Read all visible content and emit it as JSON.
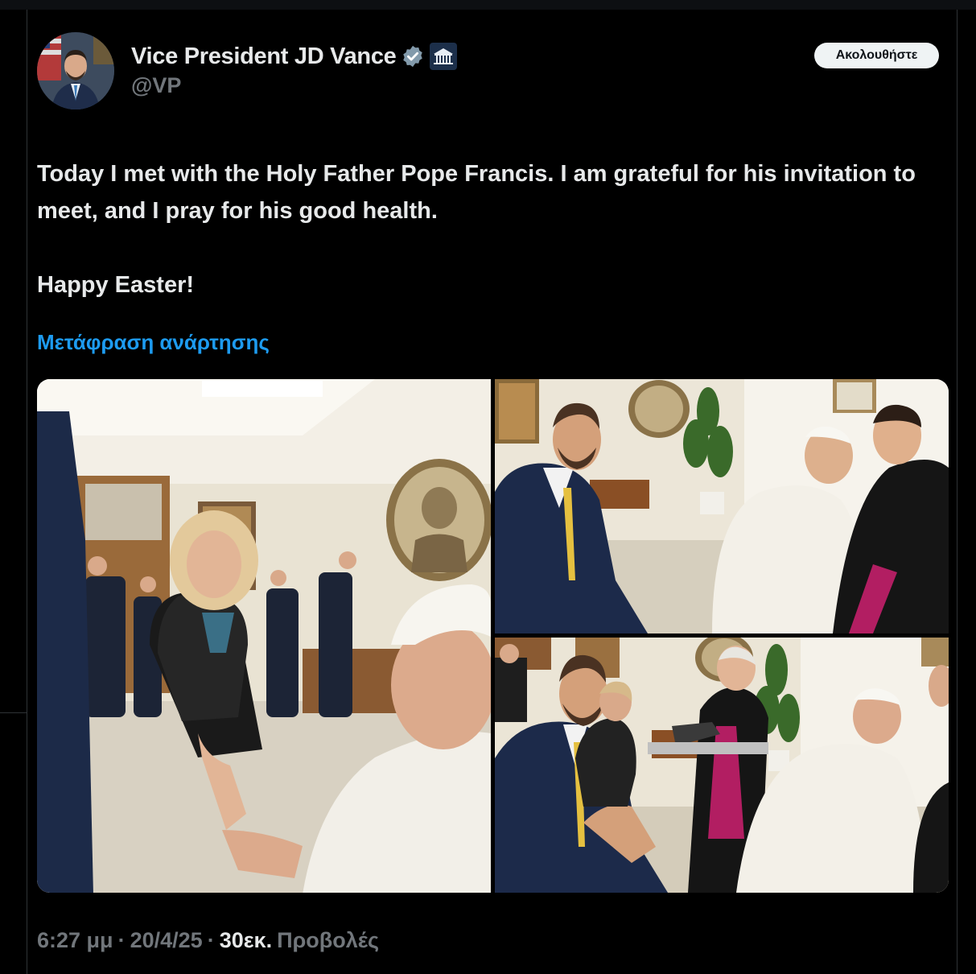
{
  "author": {
    "display_name": "Vice President JD Vance",
    "handle": "@VP",
    "avatar_icon": "profile-photo",
    "verified_icon": "verified-badge-icon",
    "affiliation_icon": "white-house-icon"
  },
  "follow_button": {
    "label": "Ακολουθήστε"
  },
  "tweet": {
    "line1": "Today I met with the Holy Father Pope Francis. I am grateful for his invitation to meet, and I pray for his good health.",
    "line2": "Happy Easter!",
    "translate_label": "Μετάφραση ανάρτησης"
  },
  "media": [
    {
      "name": "photo-woman-greeting-pope"
    },
    {
      "name": "photo-vance-with-pope"
    },
    {
      "name": "photo-gift-presentation"
    }
  ],
  "meta": {
    "time": "6:27 μμ",
    "date": "20/4/25",
    "separator": "·",
    "views_count": "30εκ.",
    "views_label": "Προβολές"
  },
  "colors": {
    "background": "#000000",
    "text_primary": "#e7e9ea",
    "text_secondary": "#71767b",
    "link": "#1d9bf0",
    "follow_button_bg": "#eff3f4",
    "verified": "#829aab"
  }
}
